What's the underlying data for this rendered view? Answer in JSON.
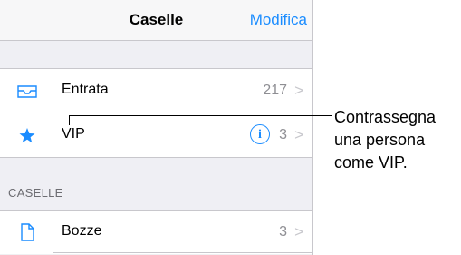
{
  "navbar": {
    "title": "Caselle",
    "edit_label": "Modifica"
  },
  "mailboxes": [
    {
      "label": "Entrata",
      "count": "217",
      "icon": "inbox-tray-icon"
    },
    {
      "label": "VIP",
      "count": "3",
      "icon": "star-icon",
      "info": "i"
    }
  ],
  "section": {
    "label": "CASELLE"
  },
  "folders": [
    {
      "label": "Bozze",
      "count": "3",
      "icon": "document-icon"
    }
  ],
  "callout": {
    "line1": "Contrassegna",
    "line2": "una persona",
    "line3": "come VIP."
  },
  "colors": {
    "accent": "#1a8cff",
    "star": "#1a8cff",
    "chevron": "#c7c7cc"
  },
  "chevron": ">"
}
